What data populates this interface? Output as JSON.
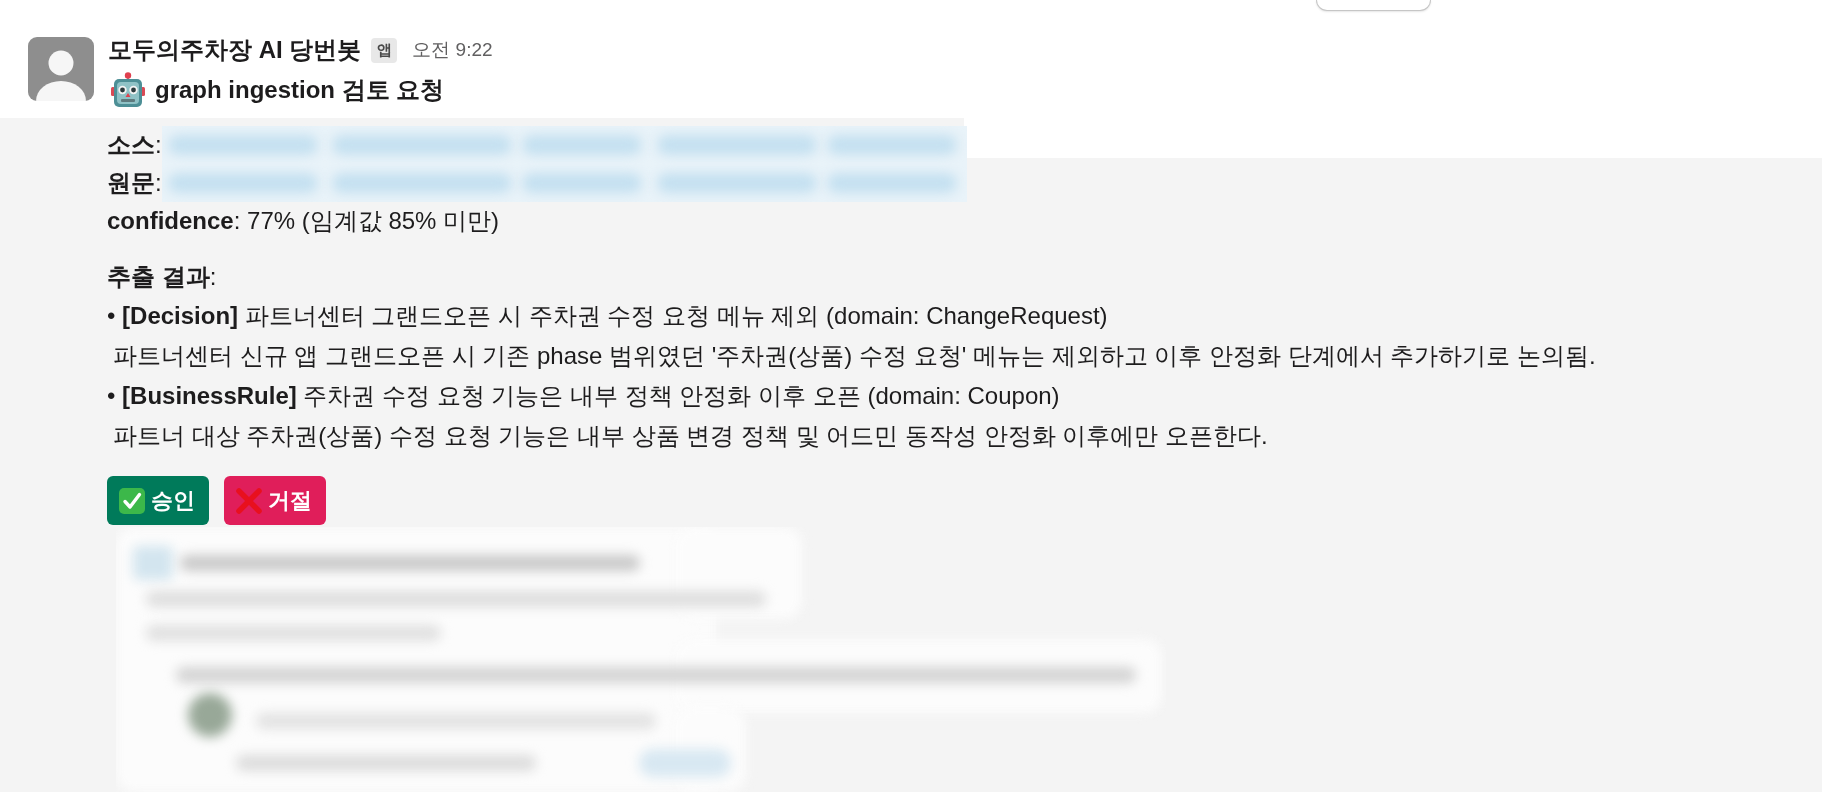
{
  "message": {
    "sender": "모두의주차장 AI 당번봇",
    "sender_badge": "앱",
    "time": "오전 9:22",
    "title": "graph ingestion 검토 요청",
    "fields": [
      {
        "text": "**소스**:",
        "redacted": true
      },
      {
        "text": "**원문**:",
        "redacted": true
      },
      {
        "text": "**confidence**: 77% (임계값 85% 미만)",
        "redacted": false
      }
    ],
    "section_heading": "**추출 결과**:",
    "items": [
      {
        "heading": "• **[Decision]** 파트너센터 그랜드오픈 시 주차권 수정 요청 메뉴 제외 (domain: ChangeRequest)",
        "description": "파트너센터 신규 앱 그랜드오픈 시 기존 phase 범위였던 '주차권(상품) 수정 요청' 메뉴는 제외하고 이후 안정화 단계에서 추가하기로 논의됨."
      },
      {
        "heading": "• **[BusinessRule]** 주차권 수정 요청 기능은 내부 정책 안정화 이후 오픈 (domain: Coupon)",
        "description": "파트너 대상 주차권(상품) 수정 요청 기능은 내부 상품 변경 정책 및 어드민 동작성 안정화 이후에만 오픈한다."
      }
    ],
    "buttons": [
      {
        "kind": "approve",
        "label": "승인"
      },
      {
        "kind": "reject",
        "label": "거절"
      }
    ]
  }
}
